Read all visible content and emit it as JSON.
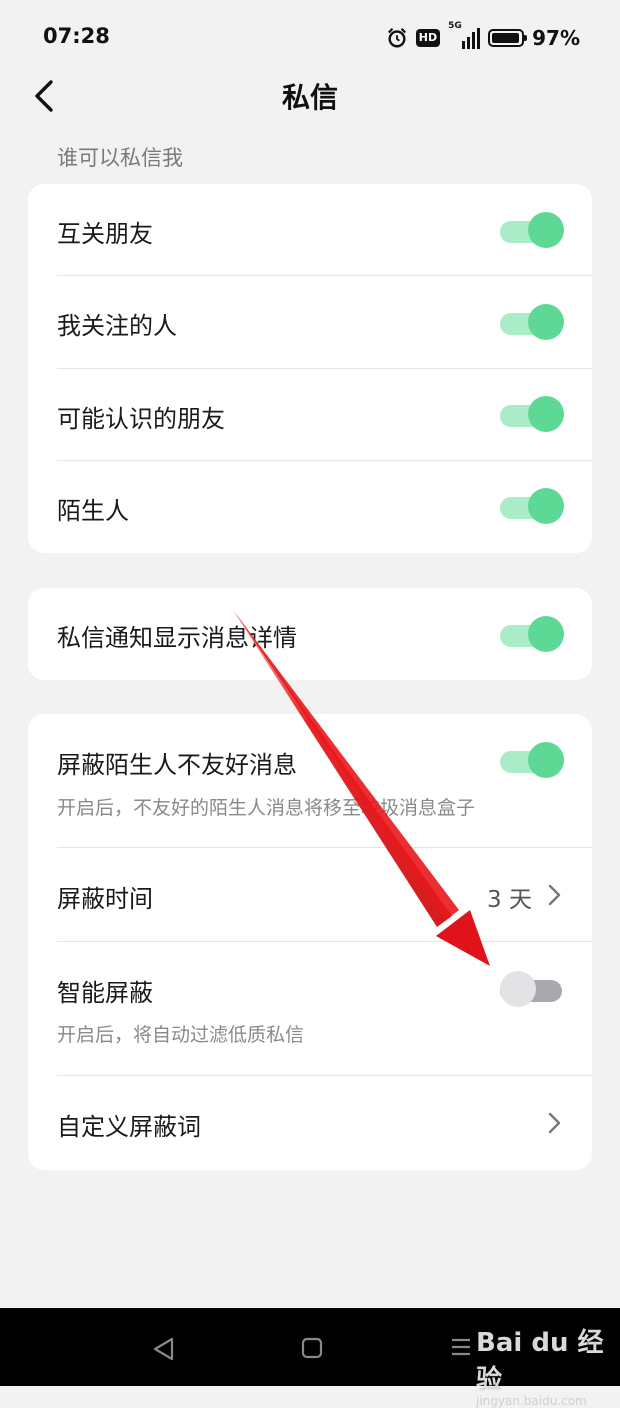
{
  "status_bar": {
    "time": "07:28",
    "hd_badge": "HD",
    "network": "5G",
    "battery_percent": "97%",
    "battery_level": 0.97
  },
  "header": {
    "title": "私信",
    "back_icon": "chevron-left-icon"
  },
  "section_label": "谁可以私信我",
  "who_can_message": [
    {
      "label": "互关朋友",
      "enabled": true
    },
    {
      "label": "我关注的人",
      "enabled": true
    },
    {
      "label": "可能认识的朋友",
      "enabled": true
    },
    {
      "label": "陌生人",
      "enabled": true
    }
  ],
  "notification": {
    "label": "私信通知显示消息详情",
    "enabled": true
  },
  "blocking": {
    "block_strangers": {
      "label": "屏蔽陌生人不友好消息",
      "description": "开启后，不友好的陌生人消息将移至垃圾消息盒子",
      "enabled": true
    },
    "block_time": {
      "label": "屏蔽时间",
      "value": "3 天"
    },
    "smart_block": {
      "label": "智能屏蔽",
      "description": "开启后，将自动过滤低质私信",
      "enabled": false
    },
    "custom_words": {
      "label": "自定义屏蔽词"
    }
  },
  "watermark": {
    "logo": "Bai du 经验",
    "url": "jingyan.baidu.com"
  },
  "colors": {
    "toggle_on_knob": "#5ed895",
    "toggle_on_track": "#a9ecc7",
    "toggle_off_track": "#a9a9ad",
    "annotation_arrow": "#e8181c",
    "background": "#f2f2f2"
  }
}
